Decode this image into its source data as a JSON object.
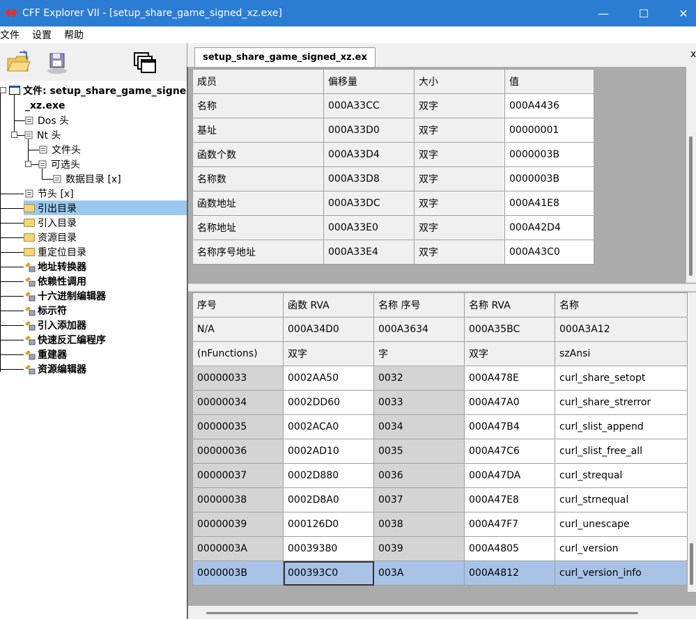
{
  "window": {
    "title": "CFF Explorer VII - [setup_share_game_signed_xz.exe]",
    "minimize": "—",
    "maximize": "☐",
    "close": "✕"
  },
  "menu": [
    "文件",
    "设置",
    "帮助"
  ],
  "toolbar": {
    "icons": [
      "open-file-icon",
      "save-file-icon",
      "windows-icon"
    ]
  },
  "tree": {
    "root_line1": "文件: setup_share_game_signed",
    "root_line2": "_xz.exe",
    "items": [
      {
        "label": "Dos 头",
        "icon": "node-icon"
      },
      {
        "label": "Nt 头",
        "icon": "node-icon"
      },
      {
        "label": "文件头",
        "icon": "node-icon"
      },
      {
        "label": "可选头",
        "icon": "node-icon"
      },
      {
        "label": "数据目录 [x]",
        "icon": "node-icon"
      },
      {
        "label": "节头 [x]",
        "icon": "node-icon"
      },
      {
        "label": "引出目录",
        "icon": "folder-icon"
      },
      {
        "label": "引入目录",
        "icon": "folder-icon"
      },
      {
        "label": "资源目录",
        "icon": "folder-icon"
      },
      {
        "label": "重定位目录",
        "icon": "folder-icon"
      },
      {
        "label": "地址转换器",
        "icon": "tool-icon"
      },
      {
        "label": "依赖性调用",
        "icon": "tool-icon"
      },
      {
        "label": "十六进制编辑器",
        "icon": "tool-icon"
      },
      {
        "label": "标示符",
        "icon": "tool-icon"
      },
      {
        "label": "引入添加器",
        "icon": "tool-icon"
      },
      {
        "label": "快速反汇编程序",
        "icon": "tool-icon"
      },
      {
        "label": "重建器",
        "icon": "tool-icon"
      },
      {
        "label": "资源编辑器",
        "icon": "tool-icon"
      }
    ]
  },
  "tab": {
    "label": "setup_share_game_signed_xz.ex",
    "close": "x"
  },
  "top_table": {
    "headers": [
      "成员",
      "偏移量",
      "大小",
      "值"
    ],
    "rows": [
      [
        "名称",
        "000A33CC",
        "双字",
        "000A4436"
      ],
      [
        "基址",
        "000A33D0",
        "双字",
        "00000001"
      ],
      [
        "函数个数",
        "000A33D4",
        "双字",
        "0000003B"
      ],
      [
        "名称数",
        "000A33D8",
        "双字",
        "0000003B"
      ],
      [
        "函数地址",
        "000A33DC",
        "双字",
        "000A41E8"
      ],
      [
        "名称地址",
        "000A33E0",
        "双字",
        "000A42D4"
      ],
      [
        "名称序号地址",
        "000A33E4",
        "双字",
        "000A43C0"
      ]
    ]
  },
  "bottom_table": {
    "headers": [
      "序号",
      "函数 RVA",
      "名称 序号",
      "名称 RVA",
      "名称"
    ],
    "meta_rows": [
      [
        "N/A",
        "000A34D0",
        "000A3634",
        "000A35BC",
        "000A3A12"
      ],
      [
        "(nFunctions)",
        "双字",
        "字",
        "双字",
        "szAnsi"
      ]
    ],
    "rows": [
      [
        "00000033",
        "0002AA50",
        "0032",
        "000A478E",
        "curl_share_setopt"
      ],
      [
        "00000034",
        "0002DD60",
        "0033",
        "000A47A0",
        "curl_share_strerror"
      ],
      [
        "00000035",
        "0002ACA0",
        "0034",
        "000A47B4",
        "curl_slist_append"
      ],
      [
        "00000036",
        "0002AD10",
        "0035",
        "000A47C6",
        "curl_slist_free_all"
      ],
      [
        "00000037",
        "0002D880",
        "0036",
        "000A47DA",
        "curl_strequal"
      ],
      [
        "00000038",
        "0002D8A0",
        "0037",
        "000A47E8",
        "curl_strnequal"
      ],
      [
        "00000039",
        "000126D0",
        "0038",
        "000A47F7",
        "curl_unescape"
      ],
      [
        "0000003A",
        "00039380",
        "0039",
        "000A4805",
        "curl_version"
      ],
      [
        "0000003B",
        "000393C0",
        "003A",
        "000A4812",
        "curl_version_info"
      ]
    ],
    "selected_row_index": 8
  },
  "colors": {
    "titlebar": "#2b7cd3",
    "tree_selection": "#99c9ef",
    "row_selection": "#a9c3e6"
  }
}
